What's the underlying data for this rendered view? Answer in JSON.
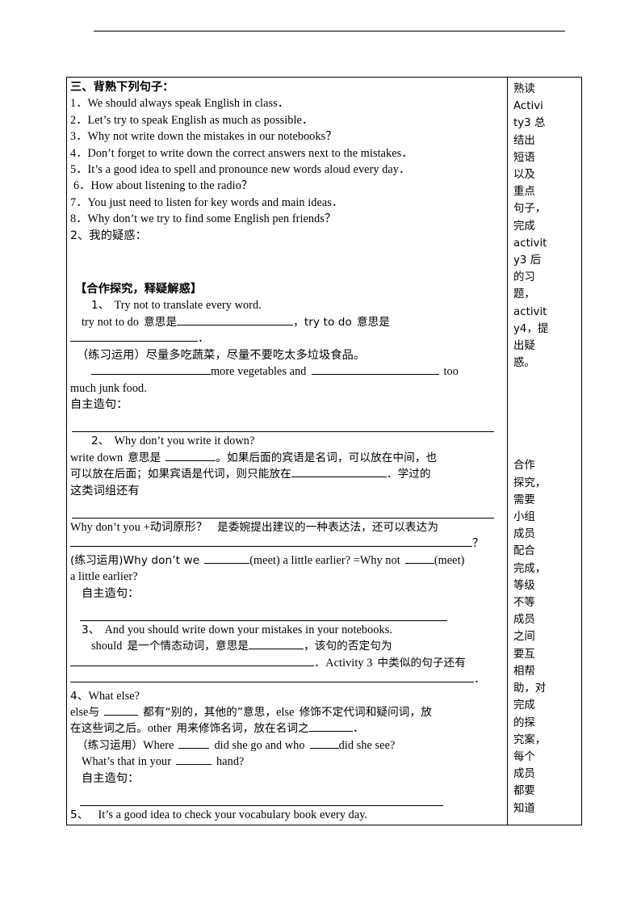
{
  "document": {
    "header_rule": true,
    "section3": {
      "heading": "三、背熟下列句子：",
      "sentences": [
        "1．We should always speak English in class．",
        "2．Let’s try to speak English as much as possible．",
        "3．Why not write down the mistakes in our notebooks？",
        "4．Don’t forget to write down the correct answers next to the mistakes．",
        "5．It’s a good idea to spell and pronounce new words aloud every day．",
        "6．How about listening to the radio？",
        "7．You just need to listen for key words and main ideas．",
        "8．Why don’t we try to find some English pen friends？"
      ],
      "doubt_label": "2、我的疑惑："
    },
    "explore": {
      "heading": "【合作探究，释疑解惑】",
      "item1": {
        "number": "1、",
        "sentence": "Try not to translate every word.",
        "line_a_pre": "try not to do",
        "line_a_mid": "意思是",
        "line_a_post": "，try to do",
        "line_a_tail": "意思是",
        "practice_label": "（练习运用）尽量多吃蔬菜，尽量不要吃太多垃圾食品。",
        "practice_en_mid": "more vegetables and",
        "practice_en_tail": "too",
        "practice_en_wrap": "much junk food.",
        "self_label": "自主造句："
      },
      "item2": {
        "number": "2、",
        "sentence": "Why don’t you write it down?",
        "exp_1": "write down",
        "exp_2": "意思是",
        "exp_3": "。如果后面的宾语是名词，可以放在中间，也",
        "exp_4": "可以放在后面；如果宾语是代词，则只能放在",
        "exp_5": "．学过的",
        "exp_6": "这类词组还有",
        "rule_line": "Why don’t you +动词原形？",
        "rule_expl": "是委婉提出建议的一种表达法，还可以表达为",
        "rule_q": "？",
        "practice_pre": "(练习运用)Why don’t we",
        "practice_mid": "(meet) a little earlier? =Why not",
        "practice_post": "(meet)",
        "practice_wrap": "a little earlier?",
        "self_label": "自主造句："
      },
      "item3": {
        "number": "3、",
        "sentence": "And you should write down your mistakes in your notebooks.",
        "exp_1": "should",
        "exp_2": "是一个情态动词，意思是",
        "exp_3": "，该句的否定句为",
        "exp_4": "．Activity 3",
        "exp_5": "中类似的句子还有",
        "tail_dot": "．"
      },
      "item4": {
        "number": "4、",
        "sentence": "What else?",
        "exp_1": "else",
        "exp_2": "与",
        "exp_3": "都有“别的，其他的”意思，",
        "exp_4": "else",
        "exp_5": "修饰不定代词和疑问词，放",
        "exp_6": "在这些词之后。",
        "exp_7": "other",
        "exp_8": "用来修饰名词，放在名词之",
        "exp_9": "．",
        "practice_label": "（练习运用）",
        "practice_1": "Where",
        "practice_2": "did she go and who",
        "practice_3": "did she see?",
        "practice_4": "What’s that in your",
        "practice_5": "hand?",
        "self_label": "自主造句："
      },
      "item5": {
        "number": "5、",
        "sentence": "It’s a good idea to check your vocabulary book every day."
      }
    },
    "sidebar": {
      "block1_lines": [
        "熟读",
        "Activi",
        "ty3 总",
        "结出",
        "短语",
        "以及",
        "重点",
        "句子，",
        "完成",
        "activit",
        "y3 后",
        "的习",
        "题，",
        "activit",
        "y4，提",
        "出疑",
        "惑。"
      ],
      "block2_lines": [
        "合作",
        "探究，",
        "需要",
        "小组",
        "成员",
        "配合",
        "完成，",
        "等级",
        "不等",
        "成员",
        "之间",
        "要互",
        "相帮",
        "助，对",
        "完成",
        "的探",
        "究案，",
        "每个",
        "成员",
        "都要",
        "知道"
      ]
    }
  }
}
